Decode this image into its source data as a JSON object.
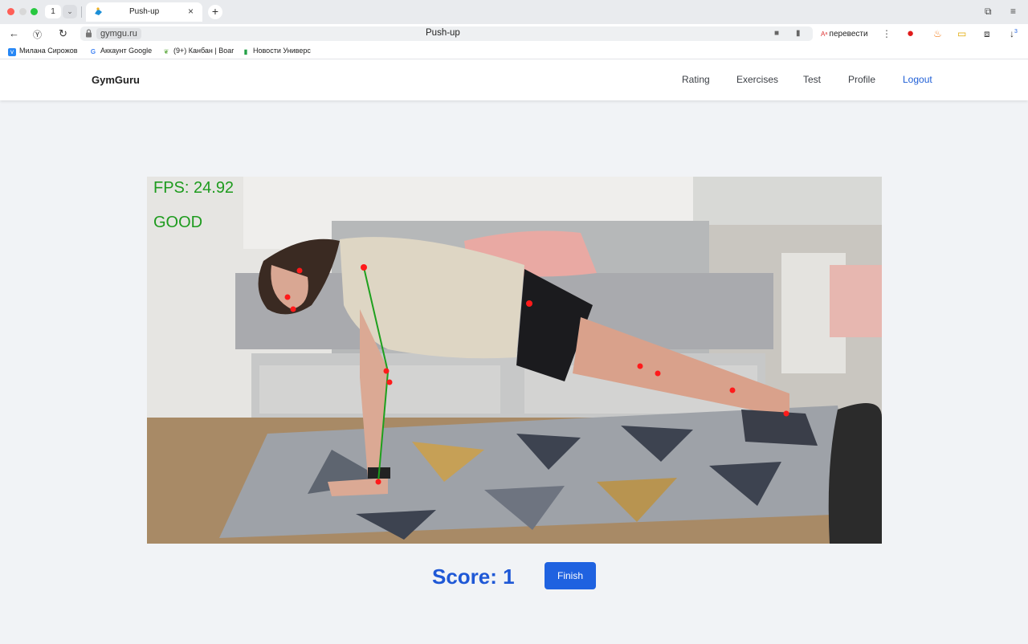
{
  "browser": {
    "tab_count": "1",
    "tab_title": "Push-up",
    "url": "gymgu.ru",
    "page_title": "Push-up",
    "translate_label": "перевести",
    "download_badge": "3",
    "bookmarks": [
      {
        "label": "Милана Сирожов",
        "icon": "vk-icon",
        "color": "#2787f5"
      },
      {
        "label": "Аккаунт Google",
        "icon": "google-icon",
        "color": "#4285f4"
      },
      {
        "label": "(9+) Канбан | Boar",
        "icon": "leaf-icon",
        "color": "#6bb04f"
      },
      {
        "label": "Новости Универс",
        "icon": "bars-icon",
        "color": "#24a148"
      }
    ]
  },
  "app": {
    "brand": "GymGuru",
    "nav": [
      "Rating",
      "Exercises",
      "Test",
      "Profile"
    ],
    "logout": "Logout"
  },
  "video": {
    "fps_text": "FPS: 24.92",
    "status_text": "GOOD",
    "overlay_color": "#1e9b1e",
    "keypoint_color": "#ff1a1a"
  },
  "footer": {
    "score": "Score: 1",
    "finish_label": "Finish"
  },
  "colors": {
    "accent": "#1f62e0",
    "link": "#1f5fd6"
  }
}
